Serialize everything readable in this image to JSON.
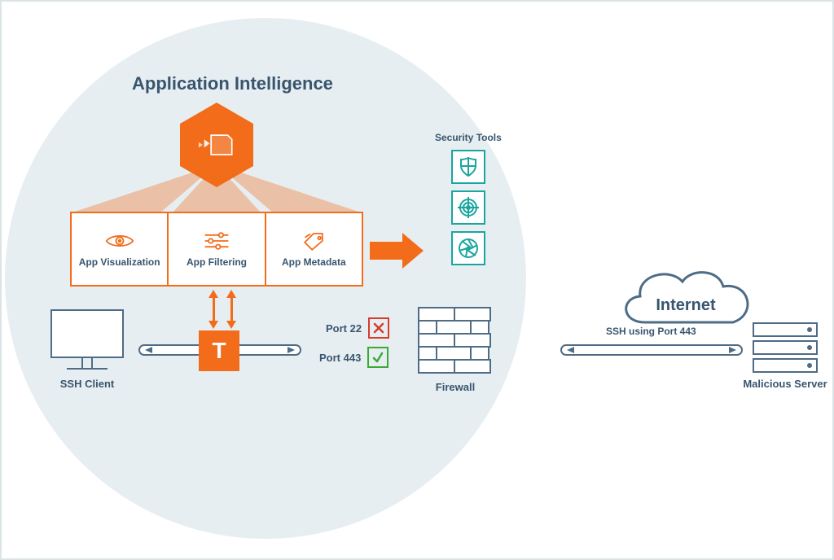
{
  "title": "Application Intelligence",
  "capabilities": [
    {
      "label": "App Visualization",
      "icon": "eye"
    },
    {
      "label": "App Filtering",
      "icon": "sliders"
    },
    {
      "label": "App Metadata",
      "icon": "tag"
    }
  ],
  "security_tools_label": "Security Tools",
  "security_tools": [
    {
      "icon": "shield"
    },
    {
      "icon": "target"
    },
    {
      "icon": "aperture"
    }
  ],
  "ports": [
    {
      "label": "Port 22",
      "status": "blocked"
    },
    {
      "label": "Port 443",
      "status": "allowed"
    }
  ],
  "ssh_client_label": "SSH Client",
  "firewall_label": "Firewall",
  "internet_label": "Internet",
  "tunnel_label": "SSH using Port 443",
  "server_label": "Malicious Server",
  "tbox_letter": "T",
  "colors": {
    "accent": "#f26c1a",
    "line": "#4e6c85",
    "teal": "#1aa6a0",
    "green": "#3aaa35",
    "red": "#d83a2c",
    "text": "#38556e"
  }
}
